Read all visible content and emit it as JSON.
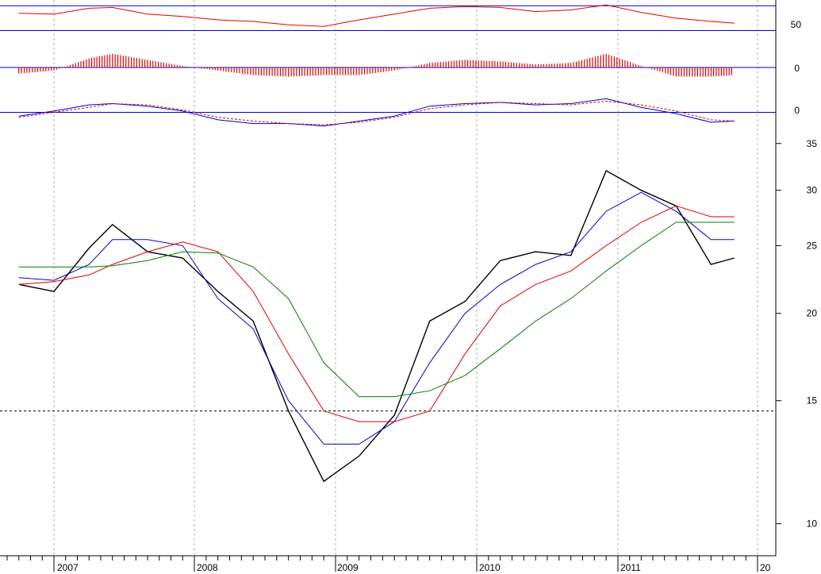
{
  "chart_data": [
    {
      "type": "line",
      "panel": "oscillator",
      "y_tick_labels": [
        "50"
      ],
      "reference_lines": [
        {
          "y": 65,
          "color": "#0000cc"
        },
        {
          "y": 35,
          "color": "#0000cc"
        }
      ],
      "ylim": [
        22,
        72
      ],
      "x": [
        "2006-10",
        "2007-01",
        "2007-04",
        "2007-06",
        "2007-09",
        "2007-12",
        "2008-03",
        "2008-06",
        "2008-09",
        "2008-12",
        "2009-03",
        "2009-06",
        "2009-09",
        "2009-12",
        "2010-03",
        "2010-06",
        "2010-09",
        "2010-12",
        "2011-03",
        "2011-06",
        "2011-09",
        "2011-11"
      ],
      "series": [
        {
          "color": "#e00000",
          "values": [
            56,
            55,
            62,
            63,
            55,
            52,
            48,
            46,
            42,
            40,
            48,
            55,
            62,
            64,
            63,
            58,
            60,
            66,
            57,
            50,
            46,
            44
          ]
        }
      ]
    },
    {
      "type": "bar",
      "panel": "histogram",
      "y_tick_labels": [
        "0"
      ],
      "reference_lines": [
        {
          "y": 0,
          "color": "#0000cc"
        }
      ],
      "ylim": [
        -1.2,
        1.2
      ],
      "x": [
        "2006-10",
        "2007-01",
        "2007-04",
        "2007-06",
        "2007-09",
        "2007-12",
        "2008-03",
        "2008-06",
        "2008-09",
        "2008-12",
        "2009-03",
        "2009-06",
        "2009-09",
        "2009-12",
        "2010-03",
        "2010-06",
        "2010-09",
        "2010-12",
        "2011-03",
        "2011-06",
        "2011-09",
        "2011-11"
      ],
      "series": [
        {
          "color": "#e00000",
          "values": [
            -0.4,
            -0.2,
            0.6,
            0.9,
            0.5,
            0.1,
            -0.2,
            -0.5,
            -0.6,
            -0.5,
            -0.5,
            -0.2,
            0.3,
            0.5,
            0.4,
            0.2,
            0.3,
            0.9,
            0.1,
            -0.6,
            -0.6,
            -0.5
          ]
        }
      ]
    },
    {
      "type": "line",
      "panel": "macd",
      "y_tick_labels": [
        "0"
      ],
      "reference_lines": [
        {
          "y": 0,
          "color": "#0000cc"
        }
      ],
      "ylim": [
        -1.5,
        1.5
      ],
      "x": [
        "2006-10",
        "2007-01",
        "2007-04",
        "2007-06",
        "2007-09",
        "2007-12",
        "2008-03",
        "2008-06",
        "2008-09",
        "2008-12",
        "2009-03",
        "2009-06",
        "2009-09",
        "2009-12",
        "2010-03",
        "2010-06",
        "2010-09",
        "2010-12",
        "2011-03",
        "2011-06",
        "2011-09",
        "2011-11"
      ],
      "series": [
        {
          "color": "#0000cc",
          "values": [
            -0.3,
            0.1,
            0.6,
            0.7,
            0.5,
            0.1,
            -0.6,
            -0.9,
            -0.9,
            -1.1,
            -0.7,
            -0.3,
            0.5,
            0.7,
            0.8,
            0.6,
            0.7,
            1.1,
            0.4,
            -0.1,
            -0.8,
            -0.7
          ]
        },
        {
          "color": "#e00000",
          "dash": true,
          "values": [
            -0.4,
            0.0,
            0.4,
            0.7,
            0.6,
            0.2,
            -0.4,
            -0.7,
            -0.9,
            -1.0,
            -0.8,
            -0.4,
            0.3,
            0.6,
            0.8,
            0.7,
            0.6,
            0.9,
            0.6,
            0.1,
            -0.6,
            -0.7
          ]
        }
      ]
    },
    {
      "type": "line",
      "panel": "price",
      "scale": "log",
      "ylim": [
        9,
        36
      ],
      "y_ticks": [
        10,
        15,
        20,
        25,
        30,
        35
      ],
      "x_tick_labels": [
        "2007",
        "2008",
        "2009",
        "2010",
        "2011",
        "20"
      ],
      "reference_lines": [
        {
          "y": 14.5,
          "color": "#000000",
          "dash": true
        }
      ],
      "x": [
        "2006-10",
        "2007-01",
        "2007-04",
        "2007-06",
        "2007-09",
        "2007-12",
        "2008-03",
        "2008-06",
        "2008-09",
        "2008-12",
        "2009-03",
        "2009-06",
        "2009-09",
        "2009-12",
        "2010-03",
        "2010-06",
        "2010-09",
        "2010-12",
        "2011-03",
        "2011-06",
        "2011-09",
        "2011-11"
      ],
      "series": [
        {
          "color": "#000000",
          "values": [
            22.0,
            21.5,
            24.8,
            26.8,
            24.5,
            24.0,
            21.5,
            19.5,
            14.5,
            11.5,
            12.5,
            14.3,
            19.5,
            20.8,
            23.8,
            24.5,
            24.2,
            32.0,
            30.0,
            28.5,
            23.5,
            24.0
          ]
        },
        {
          "color": "#0000cc",
          "values": [
            22.5,
            22.3,
            23.5,
            25.5,
            25.5,
            25.0,
            21.0,
            19.0,
            15.0,
            13.0,
            13.0,
            14.0,
            17.0,
            20.0,
            22.0,
            23.5,
            24.5,
            28.0,
            29.8,
            28.0,
            25.5,
            25.5
          ]
        },
        {
          "color": "#e00000",
          "values": [
            22.0,
            22.2,
            22.7,
            23.5,
            24.5,
            25.3,
            24.5,
            21.5,
            17.5,
            14.5,
            14.0,
            14.0,
            14.5,
            17.5,
            20.5,
            22.0,
            23.0,
            25.0,
            27.0,
            28.5,
            27.5,
            27.5
          ]
        },
        {
          "color": "#008000",
          "values": [
            23.3,
            23.3,
            23.3,
            23.4,
            23.8,
            24.5,
            24.4,
            23.3,
            21.0,
            17.0,
            15.2,
            15.2,
            15.5,
            16.3,
            17.8,
            19.5,
            21.0,
            23.0,
            25.0,
            27.0,
            27.0,
            27.0
          ]
        }
      ]
    }
  ]
}
